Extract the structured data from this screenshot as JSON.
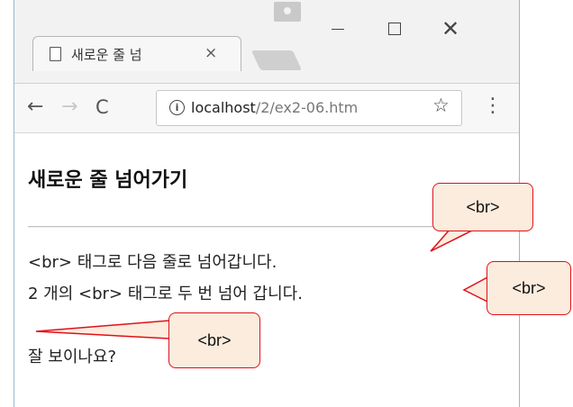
{
  "tab": {
    "title": "새로운 줄 넘",
    "close_label": "×"
  },
  "window_controls": {
    "minimize": "—",
    "maximize": "☐",
    "close": "✕"
  },
  "toolbar": {
    "back_icon": "←",
    "forward_icon": "→",
    "reload_icon": "C",
    "info_icon": "i",
    "url_host": "localhost",
    "url_path": "/2/ex2-06.htm",
    "star_icon": "☆",
    "menu_icon": "⋮"
  },
  "page": {
    "heading": "새로운 줄 넘어가기",
    "line1": "<br> 태그로 다음 줄로 넘어갑니다.",
    "line2": "2 개의 <br> 태그로 두 번 넘어 갑니다.",
    "line3": "잘 보이나요?"
  },
  "callouts": {
    "first": "<br>",
    "second": "<br>",
    "third": "<br>"
  },
  "colors": {
    "callout_border": "#e0101a",
    "callout_fill": "#fcecdd",
    "window_border": "#9ab6d1"
  }
}
